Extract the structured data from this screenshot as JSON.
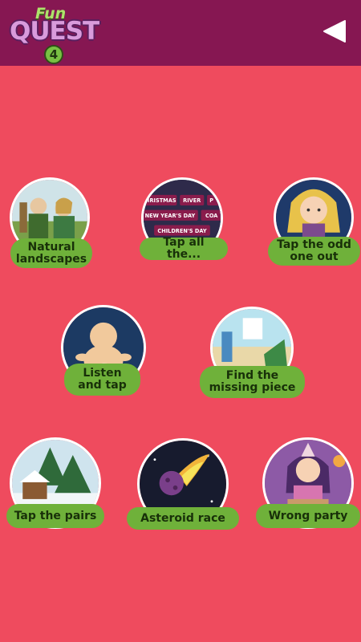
{
  "header": {
    "logo": {
      "fun": "Fun",
      "quest": "QUEST",
      "number": "4"
    },
    "back_icon": "play-triangle-icon"
  },
  "games": [
    {
      "label": "Natural\nlandscapes",
      "image": "landscape-hikers"
    },
    {
      "label": "Tap all the...",
      "image": "word-tags",
      "tags": [
        "CHRISTMAS",
        "RIVER",
        "P",
        "NEW YEAR'S DAY",
        "COA",
        "CHILDREN'S DAY"
      ]
    },
    {
      "label": "Tap the odd\none out",
      "image": "doll-girl"
    },
    {
      "label": "Listen\nand tap",
      "image": "baby"
    },
    {
      "label": "Find the\nmissing piece",
      "image": "beach-puzzle"
    },
    {
      "label": "Tap the pairs",
      "image": "snowy-village"
    },
    {
      "label": "Asteroid race",
      "image": "asteroid"
    },
    {
      "label": "Wrong party",
      "image": "birthday-girl"
    }
  ]
}
